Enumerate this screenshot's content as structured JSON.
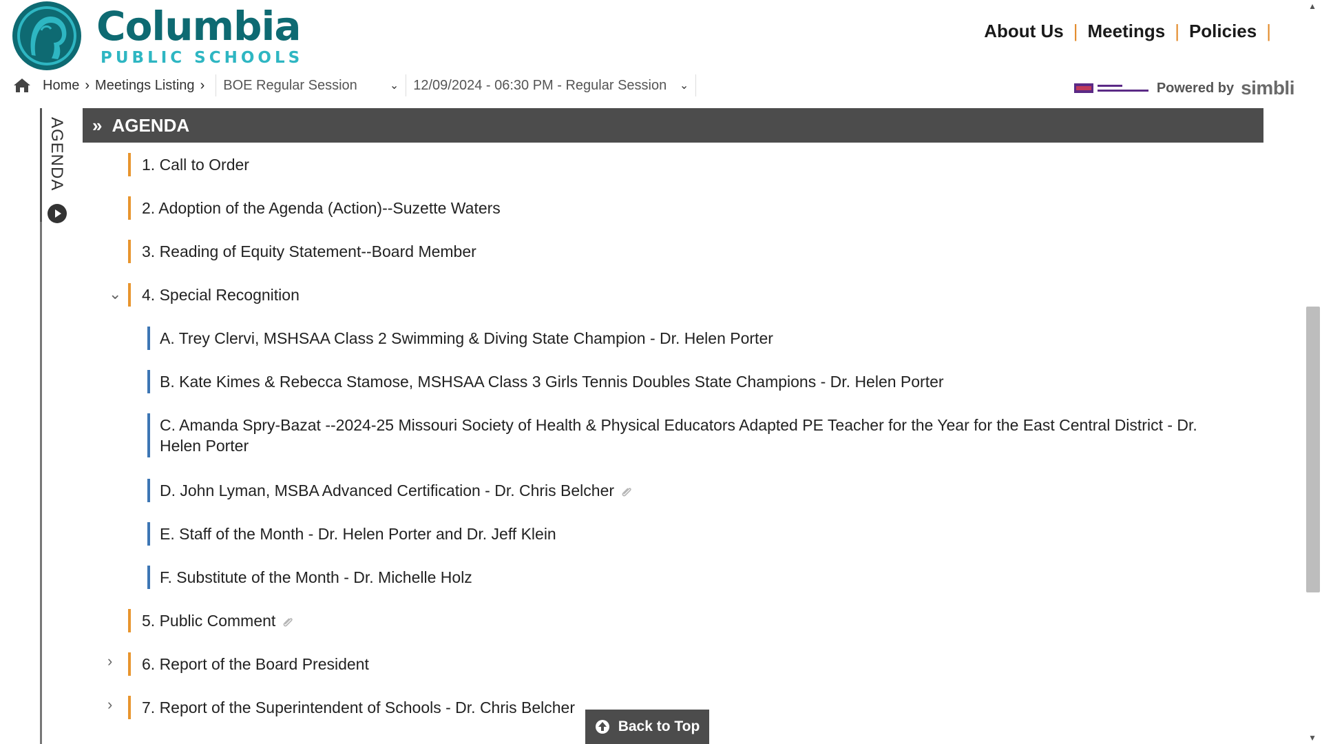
{
  "header": {
    "brand_name": "Columbia",
    "brand_sub": "PUBLIC SCHOOLS",
    "nav": [
      {
        "label": "About Us"
      },
      {
        "label": "Meetings"
      },
      {
        "label": "Policies"
      }
    ],
    "nav_separator": "|"
  },
  "breadcrumb": {
    "home": "Home",
    "meetings_listing": "Meetings Listing",
    "meeting_type": "BOE Regular Session",
    "meeting_date": "12/09/2024 - 06:30 PM - Regular Session"
  },
  "powered": {
    "text": "Powered by",
    "product": "simbli"
  },
  "side_tab": {
    "label": "AGENDA"
  },
  "agenda": {
    "title": "AGENDA",
    "items": [
      {
        "text": "1. Call to Order"
      },
      {
        "text": "2. Adoption of the Agenda (Action)--Suzette Waters"
      },
      {
        "text": "3. Reading of Equity Statement--Board Member"
      },
      {
        "text": "4. Special Recognition",
        "expanded": true,
        "children": [
          {
            "text": "A. Trey Clervi, MSHSAA Class 2 Swimming & Diving State Champion - Dr. Helen Porter"
          },
          {
            "text": "B. Kate Kimes & Rebecca Stamose, MSHSAA Class 3 Girls Tennis Doubles State Champions - Dr. Helen Porter"
          },
          {
            "text": "C. Amanda Spry-Bazat --2024-25 Missouri Society of Health & Physical Educators Adapted PE Teacher for the Year for the East Central District - Dr.",
            "text2": "Helen Porter"
          },
          {
            "text": "D. John Lyman, MSBA Advanced Certification - Dr. Chris Belcher",
            "attachment": true
          },
          {
            "text": "E. Staff of the Month - Dr. Helen Porter and Dr. Jeff Klein"
          },
          {
            "text": "F. Substitute of the Month - Dr. Michelle Holz"
          }
        ]
      },
      {
        "text": "5. Public Comment",
        "attachment": true
      },
      {
        "text": "6. Report of the Board President",
        "expanded": false
      },
      {
        "text": "7. Report of the Superintendent of Schools - Dr. Chris Belcher",
        "expanded": false
      }
    ]
  },
  "back_to_top": "Back to Top",
  "colors": {
    "brand_teal": "#0e6a72",
    "brand_light": "#2eb6c2",
    "accent_orange": "#e8952e",
    "accent_blue": "#3d76b4",
    "agenda_bar": "#4c4c4c"
  }
}
